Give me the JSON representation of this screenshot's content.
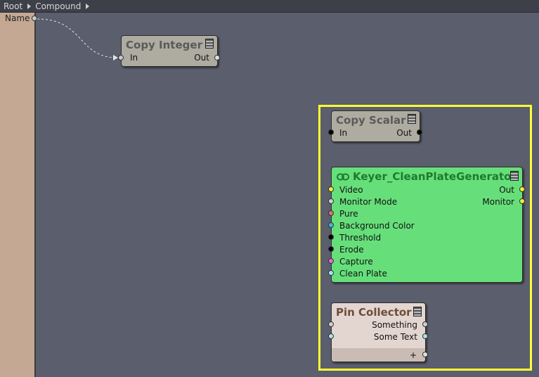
{
  "breadcrumb": [
    "Root",
    "Compound"
  ],
  "left_panel": {
    "label": "Name"
  },
  "nodes": {
    "copy_integer": {
      "title": "Copy Integer",
      "in": "In",
      "out": "Out"
    },
    "copy_scalar": {
      "title": "Copy Scalar",
      "in": "In",
      "out": "Out"
    },
    "keyer": {
      "title": "Keyer_CleanPlateGenerator",
      "inputs": [
        "Video",
        "Monitor Mode",
        "Pure",
        "Background Color",
        "Threshold",
        "Erode",
        "Capture",
        "Clean Plate"
      ],
      "outputs": [
        "Out",
        "Monitor"
      ]
    },
    "pin_collector": {
      "title": "Pin Collector",
      "outputs": [
        "Something",
        "Some Text"
      ],
      "add": "+"
    }
  },
  "colors": {
    "canvas": "#5b5e6d",
    "selection": "#ffff33",
    "node_gray": "#aeaca0",
    "keyer_green": "#66df7b",
    "pin_beige": "#e3d6d0"
  }
}
